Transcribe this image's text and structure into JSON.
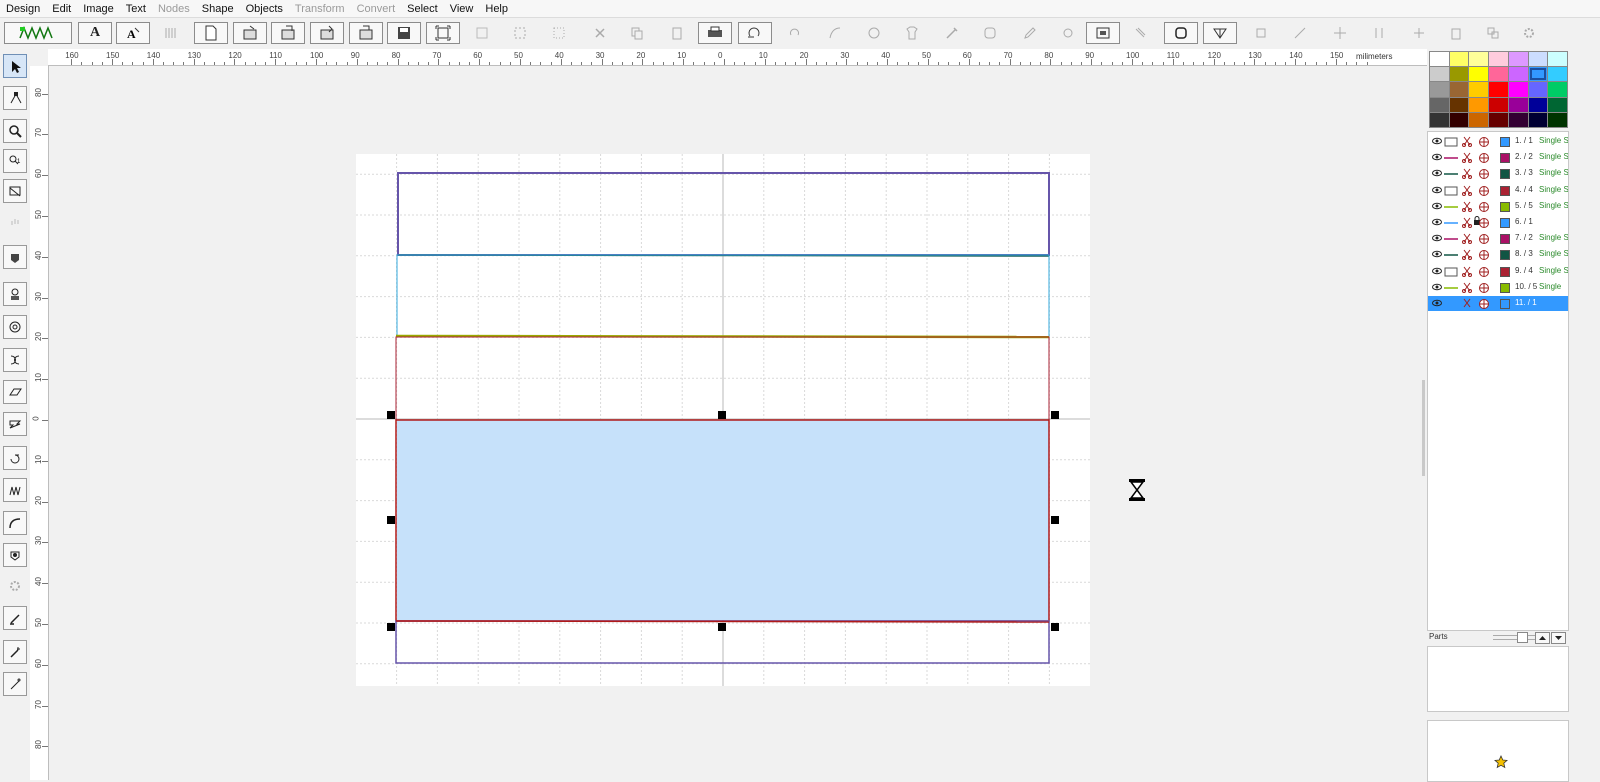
{
  "menu": [
    "Design",
    "Edit",
    "Image",
    "Text",
    "Nodes",
    "Shape",
    "Objects",
    "Transform",
    "Convert",
    "Select",
    "View",
    "Help"
  ],
  "menu_disabled": [
    "Nodes",
    "Transform",
    "Convert"
  ],
  "toolbar": {
    "stitch_icon_text": "WM",
    "text_tool_glyph": "A",
    "buttons": [
      "stitch-mode",
      "text-tool",
      "auto-text",
      "new-file",
      "open-file",
      "import-file",
      "save-as",
      "save",
      "fit-to-page",
      "select-box",
      "select-dashed",
      "delete",
      "copy",
      "paste",
      "print-preview",
      "rotate-reverse",
      "rotate",
      "curve",
      "compass",
      "shirt",
      "eyedropper",
      "hoop",
      "pen-tool",
      "thread-stop",
      "embroidery-sim",
      "ruler-b",
      "ruler-a",
      "path-edit",
      "center",
      "distribute",
      "arrange",
      "settings-gear"
    ]
  },
  "ruler": {
    "unit": "milimeters",
    "h_labels": [
      "160",
      "150",
      "140",
      "130",
      "120",
      "110",
      "100",
      "90",
      "80",
      "70",
      "60",
      "50",
      "40",
      "30",
      "20",
      "10",
      "0",
      "10",
      "20",
      "30",
      "40",
      "50",
      "60",
      "70",
      "80",
      "90",
      "100",
      "110",
      "120",
      "130",
      "140",
      "150"
    ],
    "v_labels": [
      "80",
      "70",
      "60",
      "50",
      "40",
      "30",
      "20",
      "10",
      "0",
      "10",
      "20",
      "30",
      "40",
      "50",
      "60",
      "70",
      "80"
    ]
  },
  "left_tools": [
    "select-arrow",
    "node-edit",
    "zoom",
    "zoom-1-1",
    "zoom-area",
    "pan-hand",
    "fill-shape",
    "stitch-design",
    "stamp",
    "spiral",
    "rectangle",
    "satin",
    "rotate-shape",
    "zigzag",
    "curve-line",
    "applique",
    "gear",
    "brush",
    "magic-wand",
    "needle"
  ],
  "palette": [
    "#ffffff",
    "#ffff66",
    "#ffff99",
    "#ffccdd",
    "#dd99ff",
    "#ccddff",
    "#ccffff",
    "#cccccc",
    "#999900",
    "#ffff00",
    "#ff6699",
    "#cc66ff",
    "#3399ff",
    "#33ccff",
    "#999999",
    "#996633",
    "#ffcc00",
    "#ff0000",
    "#ff00ff",
    "#6666ff",
    "#00cc66",
    "#666666",
    "#663300",
    "#ff9900",
    "#cc0000",
    "#990099",
    "#000099",
    "#006633",
    "#333333",
    "#330000",
    "#cc6600",
    "#660000",
    "#330033",
    "#000033",
    "#003300"
  ],
  "palette_selected": 12,
  "layers": [
    {
      "label": "1.  / 1",
      "type": "Single S",
      "color": "#3399ff",
      "glyph": "rect-outline"
    },
    {
      "label": "2.  / 2",
      "type": "Single S",
      "color": "#aa1166",
      "glyph": "line"
    },
    {
      "label": "3.  / 3",
      "type": "Single S",
      "color": "#115544",
      "glyph": "line"
    },
    {
      "label": "4.  / 4",
      "type": "Single S",
      "color": "#aa2233",
      "glyph": "rect-outline"
    },
    {
      "label": "5.  / 5",
      "type": "Single S",
      "color": "#88bb00",
      "glyph": "line"
    },
    {
      "label": "6.  / 1",
      "type": "",
      "color": "#3399ff",
      "glyph": "line"
    },
    {
      "label": "7.  / 2",
      "type": "Single S",
      "color": "#aa1166",
      "glyph": "line"
    },
    {
      "label": "8.  / 3",
      "type": "Single S",
      "color": "#115544",
      "glyph": "line"
    },
    {
      "label": "9.  / 4",
      "type": "Single S",
      "color": "#aa2233",
      "glyph": "rect-outline"
    },
    {
      "label": "10.  / 5",
      "type": "Single",
      "color": "#88bb00",
      "glyph": "line"
    },
    {
      "label": "11.  / 1",
      "type": "",
      "color": "#3399ff",
      "glyph": "none"
    }
  ],
  "selected_layer": 10,
  "parts": {
    "title": "Parts"
  },
  "colors": {
    "selection_fill": "#c6e1fa",
    "selection_stroke": "#b01a1a",
    "outline_purple": "#6655aa",
    "outline_cyan": "#33aadd",
    "outline_olive": "#99aa00"
  }
}
